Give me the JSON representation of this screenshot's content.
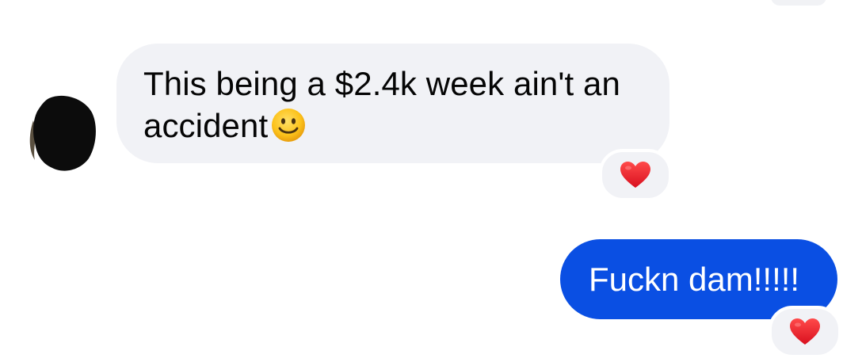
{
  "conversation": {
    "messages": [
      {
        "direction": "incoming",
        "text": "This being a $2.4k week ain't an accident",
        "emoji": "slightly-smiling-face",
        "reaction": "red-heart"
      },
      {
        "direction": "outgoing",
        "text": "Fuckn dam!!!!!",
        "reaction": "red-heart"
      }
    ]
  },
  "colors": {
    "incoming_bubble": "#f1f2f6",
    "outgoing_bubble": "#0a4fe3",
    "heart": "#e8202f",
    "avatar_redaction": "#0c0c0c"
  },
  "icons": {
    "avatar": "redacted-avatar",
    "emoji": "smile-emoji-icon",
    "reaction": "heart-icon"
  }
}
